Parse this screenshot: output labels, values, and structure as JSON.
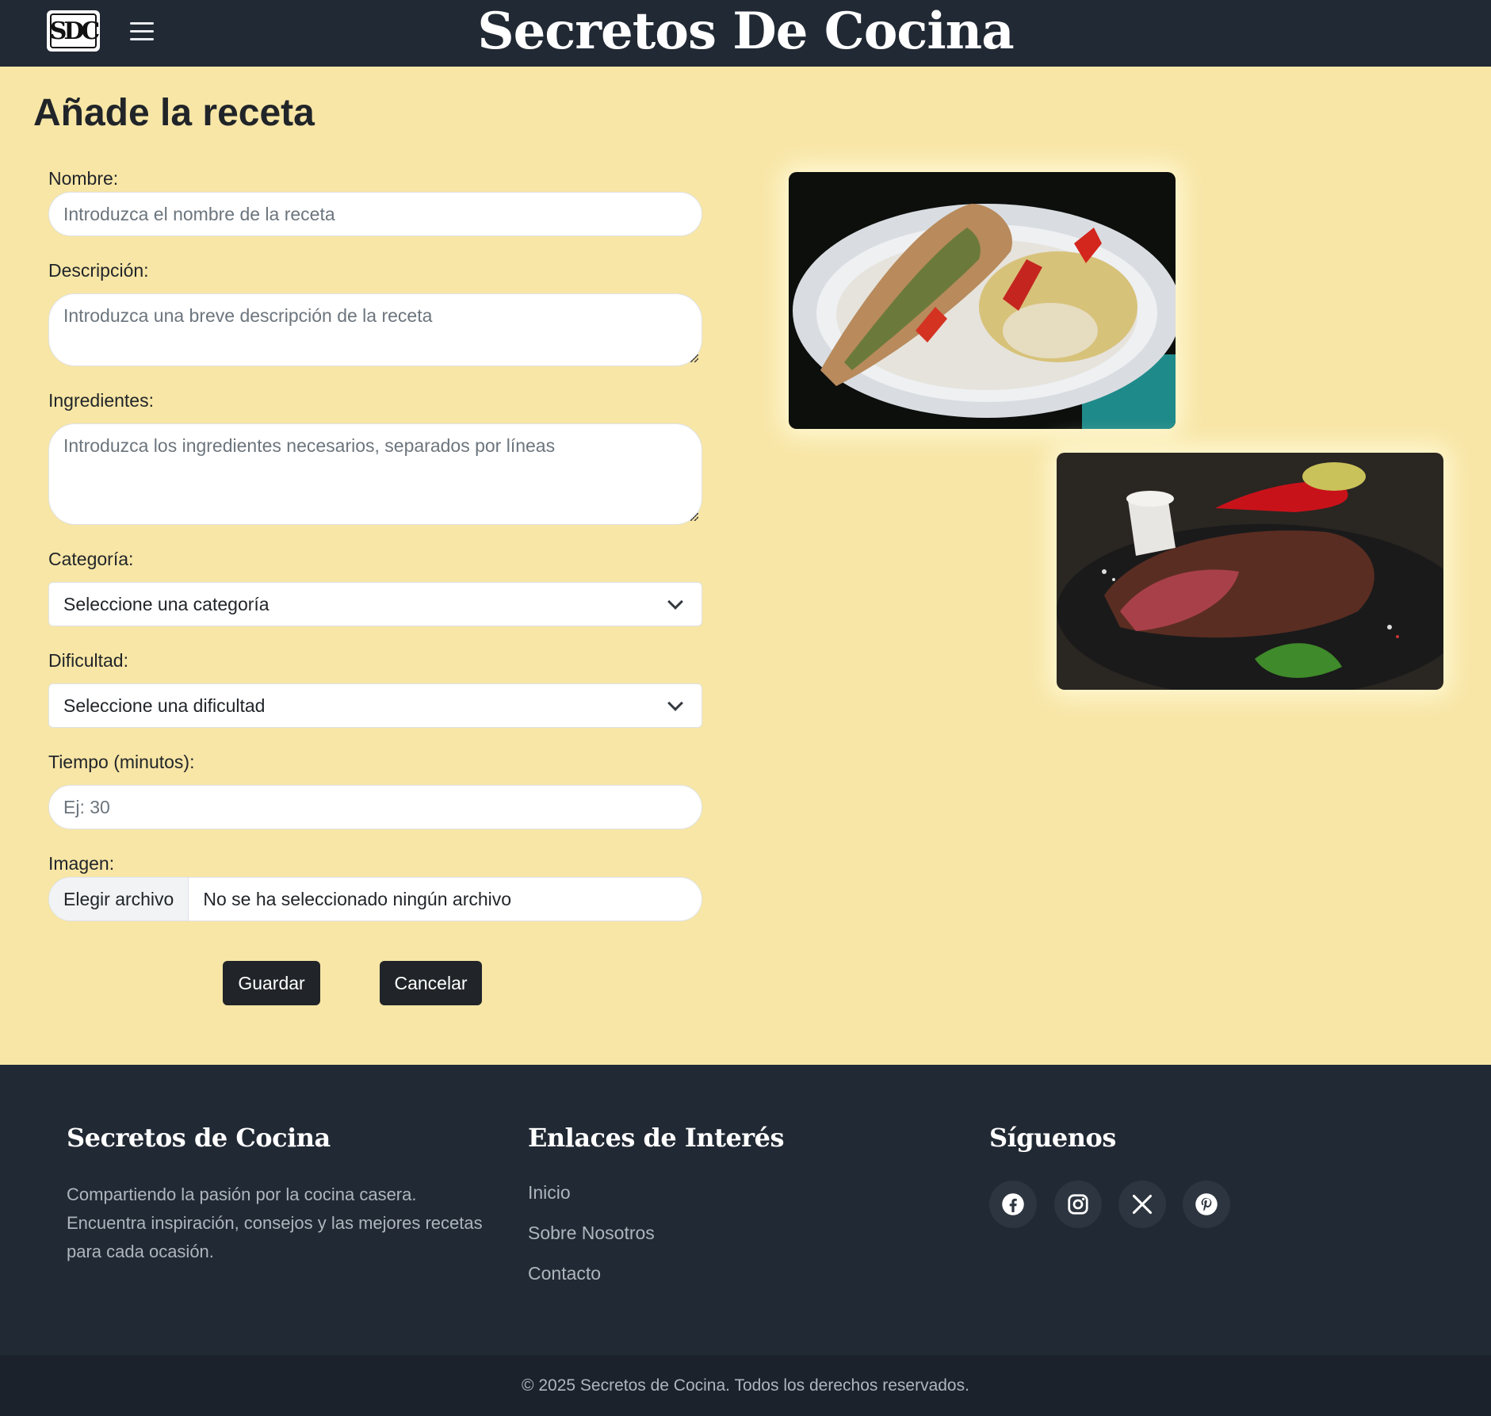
{
  "header": {
    "logo_text": "SDC",
    "site_title": "Secretos De Cocina"
  },
  "form": {
    "title": "Añade la receta",
    "nombre": {
      "label": "Nombre:",
      "placeholder": "Introduzca el nombre de la receta"
    },
    "descripcion": {
      "label": "Descripción:",
      "placeholder": "Introduzca una breve descripción de la receta"
    },
    "ingredientes": {
      "label": "Ingredientes:",
      "placeholder": "Introduzca los ingredientes necesarios, separados por líneas"
    },
    "categoria": {
      "label": "Categoría:",
      "selected": "Seleccione una categoría"
    },
    "dificultad": {
      "label": "Dificultad:",
      "selected": "Seleccione una dificultad"
    },
    "tiempo": {
      "label": "Tiempo (minutos):",
      "placeholder": "Ej: 30"
    },
    "imagen": {
      "label": "Imagen:",
      "button": "Elegir archivo",
      "status": "No se ha seleccionado ningún archivo"
    },
    "save_label": "Guardar",
    "cancel_label": "Cancelar"
  },
  "footer": {
    "about_title": "Secretos de Cocina",
    "about_text": "Compartiendo la pasión por la cocina casera. Encuentra inspiración, consejos y las mejores recetas para cada ocasión.",
    "links_title": "Enlaces de Interés",
    "links": [
      "Inicio",
      "Sobre Nosotros",
      "Contacto"
    ],
    "social_title": "Síguenos",
    "social_icons": [
      "facebook-icon",
      "instagram-icon",
      "x-icon",
      "pinterest-icon"
    ],
    "copyright": "© 2025 Secretos de Cocina. Todos los derechos reservados."
  },
  "colors": {
    "page_bg": "#f8e6a6",
    "header_bg": "#212934",
    "footer_bg": "#212934",
    "button_bg": "#212529"
  }
}
